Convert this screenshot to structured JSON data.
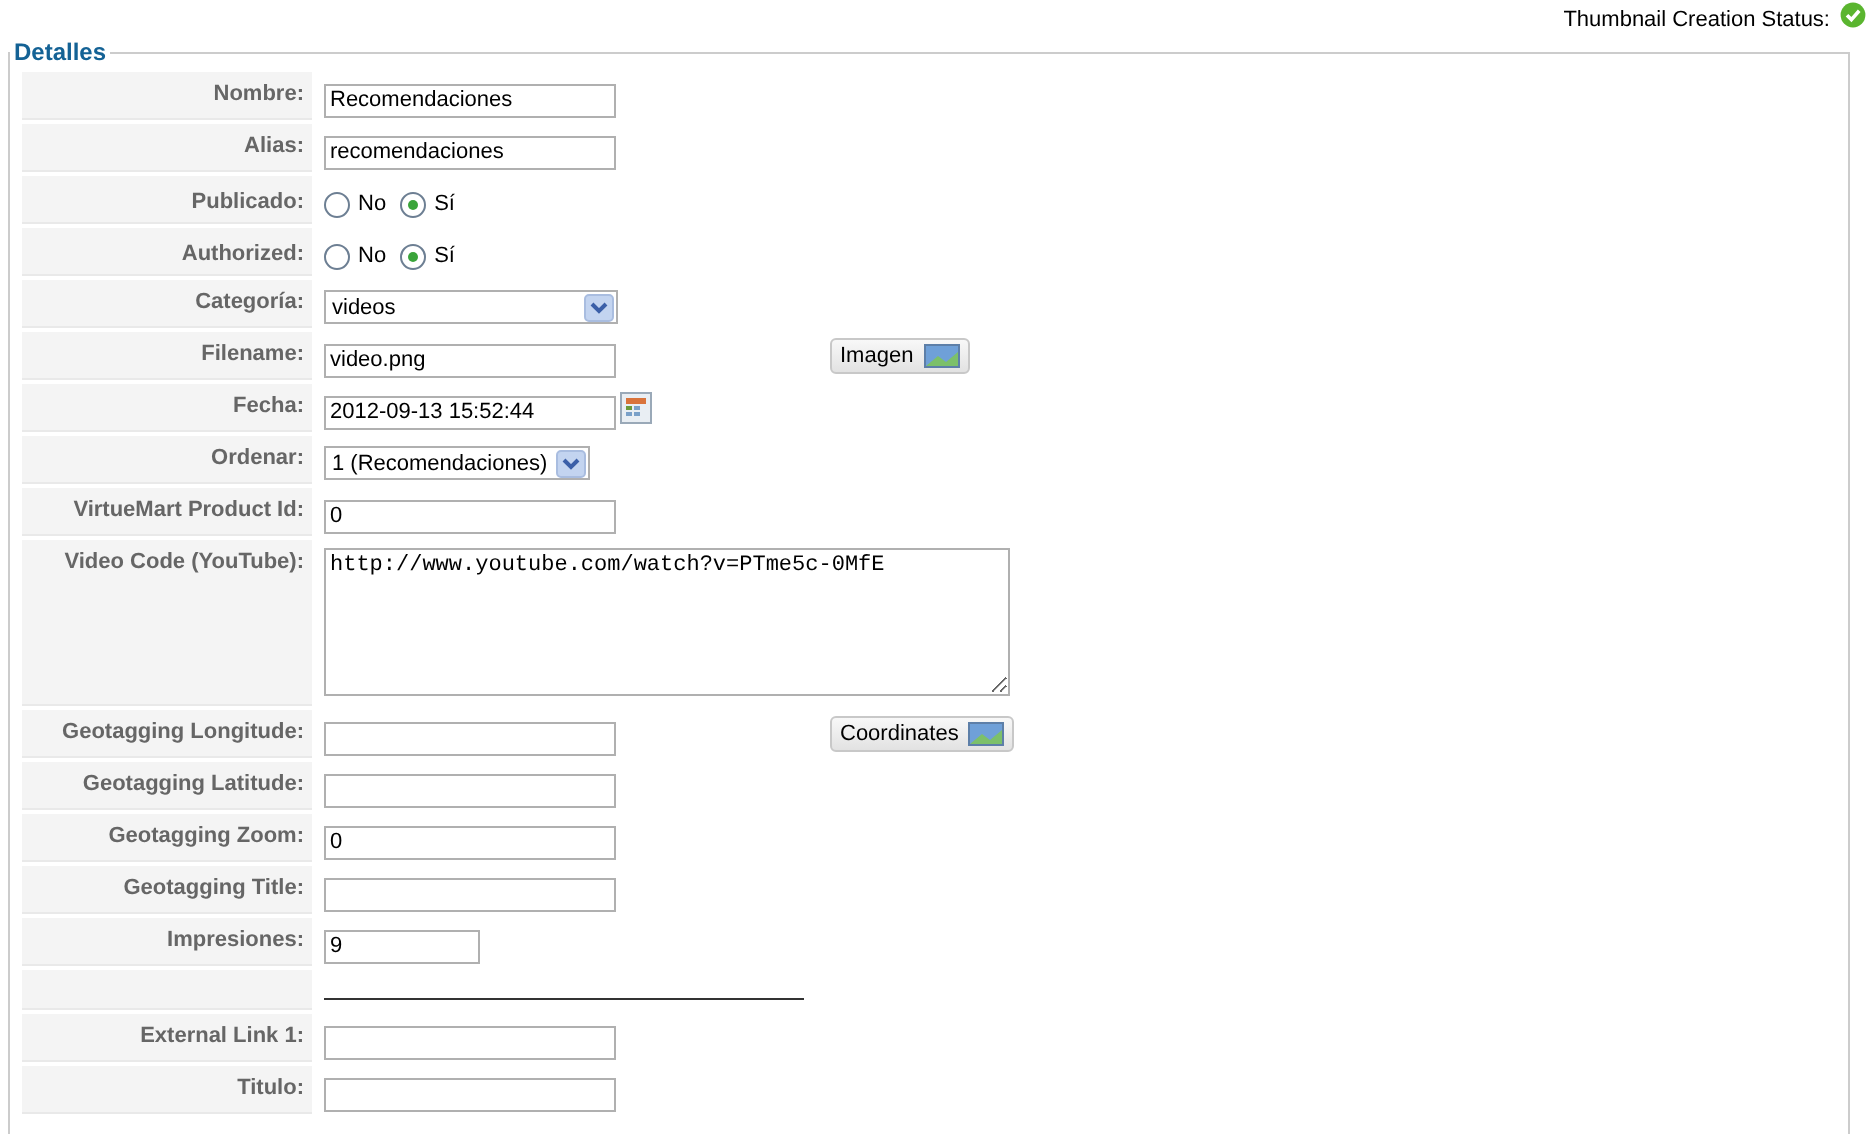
{
  "status": {
    "label": "Thumbnail Creation Status:",
    "ok": true
  },
  "fieldset": {
    "legend": "Detalles"
  },
  "rows": [
    {
      "kind": "text",
      "label": "Nombre:",
      "value": "Recomendaciones"
    },
    {
      "kind": "text",
      "label": "Alias:",
      "value": "recomendaciones"
    },
    {
      "kind": "radio",
      "label": "Publicado:",
      "options": [
        {
          "label": "No",
          "selected": false
        },
        {
          "label": "Sí",
          "selected": true
        }
      ]
    },
    {
      "kind": "radio",
      "label": "Authorized:",
      "options": [
        {
          "label": "No",
          "selected": false
        },
        {
          "label": "Sí",
          "selected": true
        }
      ]
    },
    {
      "kind": "select",
      "label": "Categoría:",
      "value": "videos"
    },
    {
      "kind": "text",
      "label": "Filename:",
      "value": "video.png",
      "button": "Imagen"
    },
    {
      "kind": "text",
      "label": "Fecha:",
      "value": "2012-09-13 15:52:44",
      "calendar": true
    },
    {
      "kind": "combo",
      "label": "Ordenar:",
      "value": "1 (Recomendaciones)"
    },
    {
      "kind": "text",
      "label": "VirtueMart Product Id:",
      "value": "0"
    },
    {
      "kind": "textarea",
      "label": "Video Code (YouTube):",
      "value": "http://www.youtube.com/watch?v=PTme5c-0MfE"
    },
    {
      "kind": "text",
      "label": "Geotagging Longitude:",
      "value": "",
      "button": "Coordinates"
    },
    {
      "kind": "text",
      "label": "Geotagging Latitude:",
      "value": ""
    },
    {
      "kind": "text",
      "label": "Geotagging Zoom:",
      "value": "0"
    },
    {
      "kind": "text",
      "label": "Geotagging Title:",
      "value": ""
    },
    {
      "kind": "number",
      "label": "Impresiones:",
      "value": "9"
    },
    {
      "kind": "divider"
    },
    {
      "kind": "text",
      "label": "External Link 1:",
      "value": ""
    },
    {
      "kind": "text",
      "label": "Titulo:",
      "value": ""
    }
  ]
}
